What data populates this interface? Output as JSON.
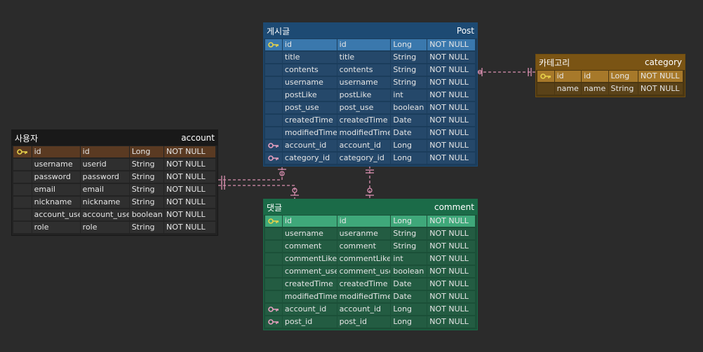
{
  "tables": {
    "post": {
      "title_kr": "게시글",
      "title_en": "Post",
      "columns": [
        {
          "key": "pk",
          "logical": "id",
          "physical": "id",
          "type": "Long",
          "null": "NOT NULL"
        },
        {
          "key": "",
          "logical": "title",
          "physical": "title",
          "type": "String",
          "null": "NOT NULL"
        },
        {
          "key": "",
          "logical": "contents",
          "physical": "contents",
          "type": "String",
          "null": "NOT NULL"
        },
        {
          "key": "",
          "logical": "username",
          "physical": "username",
          "type": "String",
          "null": "NOT NULL"
        },
        {
          "key": "",
          "logical": "postLike",
          "physical": "postLike",
          "type": "int",
          "null": "NOT NULL"
        },
        {
          "key": "",
          "logical": "post_use",
          "physical": "post_use",
          "type": "boolean",
          "null": "NOT NULL"
        },
        {
          "key": "",
          "logical": "createdTime",
          "physical": "createdTime",
          "type": "Date",
          "null": "NOT NULL"
        },
        {
          "key": "",
          "logical": "modifiedTime",
          "physical": "modifiedTime",
          "type": "Date",
          "null": "NOT NULL"
        },
        {
          "key": "fk",
          "logical": "account_id",
          "physical": "account_id",
          "type": "Long",
          "null": "NOT NULL"
        },
        {
          "key": "fk",
          "logical": "category_id",
          "physical": "category_id",
          "type": "Long",
          "null": "NOT NULL"
        }
      ]
    },
    "category": {
      "title_kr": "카테고리",
      "title_en": "category",
      "columns": [
        {
          "key": "pk",
          "logical": "id",
          "physical": "id",
          "type": "Long",
          "null": "NOT NULL"
        },
        {
          "key": "",
          "logical": "name",
          "physical": "name",
          "type": "String",
          "null": "NOT NULL"
        }
      ]
    },
    "account": {
      "title_kr": "사용자",
      "title_en": "account",
      "columns": [
        {
          "key": "pk",
          "logical": "id",
          "physical": "id",
          "type": "Long",
          "null": "NOT NULL"
        },
        {
          "key": "",
          "logical": "username",
          "physical": "userid",
          "type": "String",
          "null": "NOT NULL"
        },
        {
          "key": "",
          "logical": "password",
          "physical": "password",
          "type": "String",
          "null": "NOT NULL"
        },
        {
          "key": "",
          "logical": "email",
          "physical": "email",
          "type": "String",
          "null": "NOT NULL"
        },
        {
          "key": "",
          "logical": "nickname",
          "physical": "nickname",
          "type": "String",
          "null": "NOT NULL"
        },
        {
          "key": "",
          "logical": "account_use",
          "physical": "account_use",
          "type": "boolean",
          "null": "NOT NULL"
        },
        {
          "key": "",
          "logical": "role",
          "physical": "role",
          "type": "String",
          "null": "NOT NULL"
        }
      ]
    },
    "comment": {
      "title_kr": "댓글",
      "title_en": "comment",
      "columns": [
        {
          "key": "pk",
          "logical": "id",
          "physical": "id",
          "type": "Long",
          "null": "NOT NULL"
        },
        {
          "key": "",
          "logical": "username",
          "physical": "useranme",
          "type": "String",
          "null": "NOT NULL"
        },
        {
          "key": "",
          "logical": "comment",
          "physical": "comment",
          "type": "String",
          "null": "NOT NULL"
        },
        {
          "key": "",
          "logical": "commentLike",
          "physical": "commentLike",
          "type": "int",
          "null": "NOT NULL"
        },
        {
          "key": "",
          "logical": "comment_use",
          "physical": "comment_use",
          "type": "boolean",
          "null": "NOT NULL"
        },
        {
          "key": "",
          "logical": "createdTime",
          "physical": "createdTime",
          "type": "Date",
          "null": "NOT NULL"
        },
        {
          "key": "",
          "logical": "modifiedTime",
          "physical": "modifiedTime",
          "type": "Date",
          "null": "NOT NULL"
        },
        {
          "key": "fk",
          "logical": "account_id",
          "physical": "account_id",
          "type": "Long",
          "null": "NOT NULL"
        },
        {
          "key": "fk",
          "logical": "post_id",
          "physical": "post_id",
          "type": "Long",
          "null": "NOT NULL"
        }
      ]
    }
  },
  "relationships": [
    {
      "from": "category",
      "to": "post",
      "kind": "one-to-many",
      "line_color": "#d98fb0"
    },
    {
      "from": "account",
      "to": "post",
      "kind": "one-to-many",
      "line_color": "#d98fb0"
    },
    {
      "from": "account",
      "to": "comment",
      "kind": "one-to-many",
      "line_color": "#d98fb0"
    },
    {
      "from": "post",
      "to": "comment",
      "kind": "one-to-many",
      "line_color": "#d98fb0"
    }
  ],
  "colors": {
    "background": "#2b2b2b",
    "post_accent": "#1d4a73",
    "category_accent": "#7a5414",
    "account_accent": "#191919",
    "comment_accent": "#1b6b48",
    "primary_key_icon": "#e8d34a",
    "foreign_key_icon": "#e6a0bf"
  },
  "icons": {
    "pk": "primary-key-icon",
    "fk": "foreign-key-icon"
  }
}
